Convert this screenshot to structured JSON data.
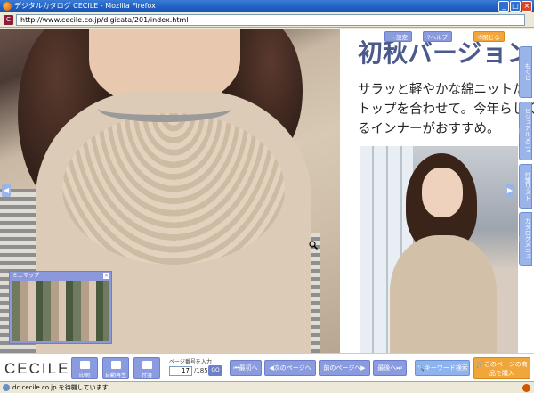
{
  "window": {
    "title": "デジタルカタログ CECILE - Mozilla Firefox",
    "controls": {
      "minimize": "_",
      "maximize": "□",
      "close": "×"
    }
  },
  "address": {
    "url": "http://www.cecile.co.jp/digicata/201/index.html"
  },
  "page": {
    "title": "初秋バージョン",
    "body_lines": [
      "サラッと軽やかな綿ニットだ",
      "トップを合わせて。今年らしく",
      "るインナーがおすすめ。"
    ]
  },
  "top_buttons": {
    "settings": "設定",
    "help": "ヘルプ",
    "exit": "閉じる"
  },
  "side_tabs": [
    "もくじ",
    "ビジュアルメニュー",
    "付箋リスト",
    "カタログメニュー"
  ],
  "thumbnail": {
    "title": "ミニマップ",
    "close": "×"
  },
  "toolbar": {
    "logo": "CECILE",
    "print": "印刷",
    "autoplay": "自動再生",
    "sticky": "付箋",
    "page_label": "ページ番号を入力",
    "page_current": "17",
    "page_total": "/185",
    "go": "GO",
    "first_page": "最初へ",
    "next_page": "次のページへ",
    "prev_page": "前のページへ",
    "last_page": "最後へ",
    "keyword_search": "キーワード検索",
    "buy": "このページの商品を購入"
  },
  "status": {
    "text": "dc.cecile.co.jp を待機しています..."
  },
  "colors": {
    "accent": "#8a9be0",
    "buy": "#f0a63a",
    "title_text": "#4b5a8c"
  }
}
